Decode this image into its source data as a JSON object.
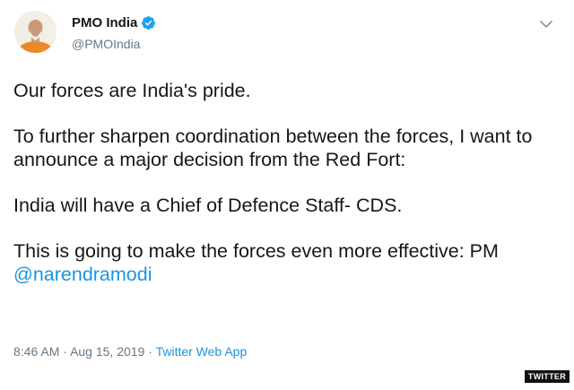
{
  "author": {
    "display_name": "PMO India",
    "handle": "@PMOIndia",
    "avatar_icon": "person-avatar-icon",
    "verified_icon": "verified-badge-icon"
  },
  "menu": {
    "icon": "chevron-down-icon"
  },
  "tweet": {
    "paragraphs": [
      "Our forces are India's pride.",
      "To further sharpen coordination between the forces, I want to announce a major decision from the Red Fort:",
      "India will have a Chief of Defence Staff- CDS.",
      "This is going to make the forces even more effective: PM"
    ],
    "mention": "@narendramodi"
  },
  "meta": {
    "time": "8:46 AM",
    "date": "Aug 15, 2019",
    "separator": "·",
    "source": "Twitter Web App"
  },
  "watermark": "TWITTER",
  "colors": {
    "link": "#1b95e0",
    "text": "#14171a",
    "secondary": "#657786",
    "verified": "#1da1f2"
  }
}
